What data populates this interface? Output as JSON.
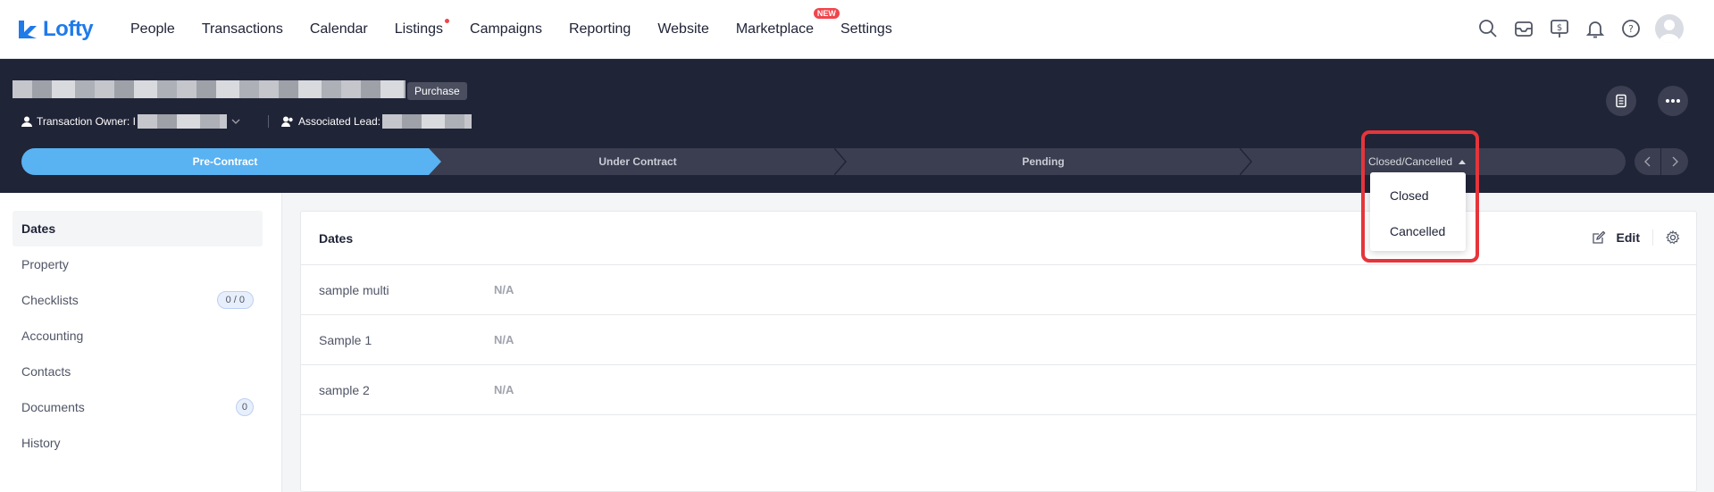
{
  "app": {
    "name": "Lofty",
    "brand_color": "#1f7aea"
  },
  "nav": {
    "items": [
      {
        "label": "People"
      },
      {
        "label": "Transactions"
      },
      {
        "label": "Calendar"
      },
      {
        "label": "Listings"
      },
      {
        "label": "Campaigns"
      },
      {
        "label": "Reporting"
      },
      {
        "label": "Website"
      },
      {
        "label": "Marketplace"
      },
      {
        "label": "Settings"
      }
    ],
    "new_badge": "NEW",
    "icons": [
      "search-icon",
      "inbox-icon",
      "billing-icon",
      "bell-icon",
      "help-icon",
      "avatar"
    ]
  },
  "header": {
    "type_tag": "Purchase",
    "owner_label": "Transaction Owner: I",
    "lead_label": "Associated Lead:",
    "bg_color": "#202437"
  },
  "pipeline": {
    "stages": [
      {
        "label": "Pre-Contract",
        "active": true
      },
      {
        "label": "Under Contract",
        "active": false
      },
      {
        "label": "Pending",
        "active": false
      },
      {
        "label": "Closed/Cancelled",
        "active": false
      }
    ],
    "active_color": "#59b2f2"
  },
  "dropdown": {
    "options": [
      "Closed",
      "Cancelled"
    ],
    "highlight_color": "#e5353b"
  },
  "sidebar": {
    "items": [
      {
        "label": "Dates",
        "active": true,
        "badge": ""
      },
      {
        "label": "Property",
        "active": false,
        "badge": ""
      },
      {
        "label": "Checklists",
        "active": false,
        "badge": "0 / 0"
      },
      {
        "label": "Accounting",
        "active": false,
        "badge": ""
      },
      {
        "label": "Contacts",
        "active": false,
        "badge": ""
      },
      {
        "label": "Documents",
        "active": false,
        "badge": "0"
      },
      {
        "label": "History",
        "active": false,
        "badge": ""
      }
    ]
  },
  "card": {
    "title": "Dates",
    "edit_label": "Edit",
    "rows": [
      {
        "label": "sample multi",
        "value": "N/A"
      },
      {
        "label": "Sample 1",
        "value": "N/A"
      },
      {
        "label": "sample 2",
        "value": "N/A"
      }
    ]
  }
}
